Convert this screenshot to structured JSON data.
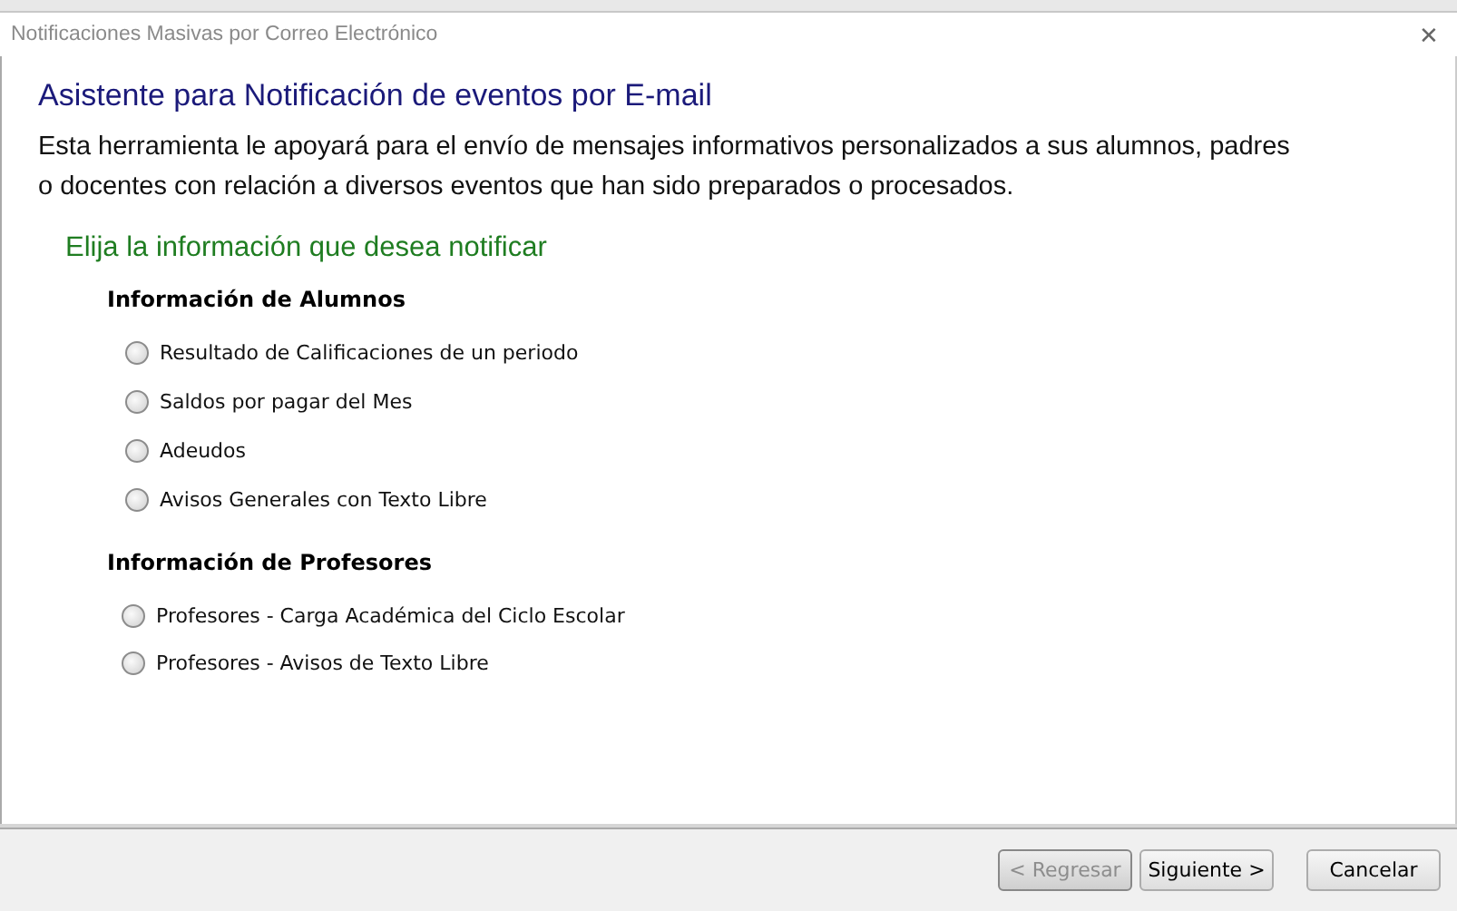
{
  "window": {
    "title": "Notificaciones Masivas por Correo Electrónico",
    "close": "✕"
  },
  "heading": "Asistente para Notificación de eventos por E-mail",
  "description": "Esta herramienta le apoyará para el envío de mensajes informativos personalizados a sus alumnos, padres o docentes con relación a diversos eventos que han sido preparados o procesados.",
  "prompt": "Elija la información que desea notificar",
  "groups": [
    {
      "title": "Información de Alumnos",
      "options": [
        {
          "label": "Resultado de Calificaciones de un periodo",
          "selected": false
        },
        {
          "label": "Saldos por pagar del Mes",
          "selected": false
        },
        {
          "label": "Adeudos",
          "selected": false
        },
        {
          "label": "Avisos Generales con Texto Libre",
          "selected": false
        }
      ]
    },
    {
      "title": "Información de Profesores",
      "options": [
        {
          "label": "Profesores - Carga Académica del Ciclo Escolar",
          "selected": false
        },
        {
          "label": "Profesores - Avisos de Texto Libre",
          "selected": false
        }
      ]
    }
  ],
  "buttons": [
    {
      "label": "< Regresar",
      "disabled": true
    },
    {
      "label": "Siguiente >",
      "disabled": false
    },
    {
      "label": "Cancelar",
      "disabled": false
    }
  ]
}
